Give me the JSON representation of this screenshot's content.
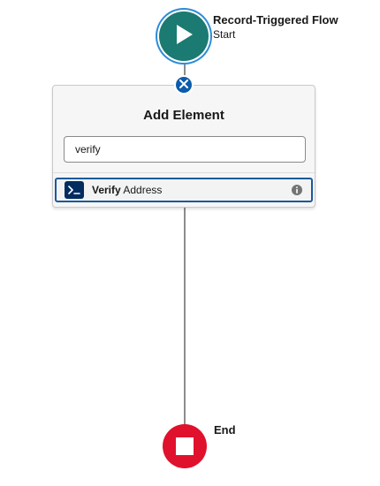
{
  "start": {
    "title": "Record-Triggered Flow",
    "subtitle": "Start",
    "icon": "play-icon"
  },
  "add_element": {
    "title": "Add Element",
    "search_value": "verify",
    "results": [
      {
        "bold_part": "Verify",
        "rest_part": " Address",
        "icon": "apex-action-icon",
        "info_icon": "info-icon"
      }
    ],
    "close_icon": "close-icon"
  },
  "end": {
    "label": "End",
    "icon": "stop-icon"
  },
  "colors": {
    "start_node": "#1b7a72",
    "end_node": "#e0112d",
    "accent_blue": "#0b5cab",
    "selected_border": "#1b5a9b",
    "action_icon_bg": "#032d60",
    "connector": "#8c8c8c"
  }
}
